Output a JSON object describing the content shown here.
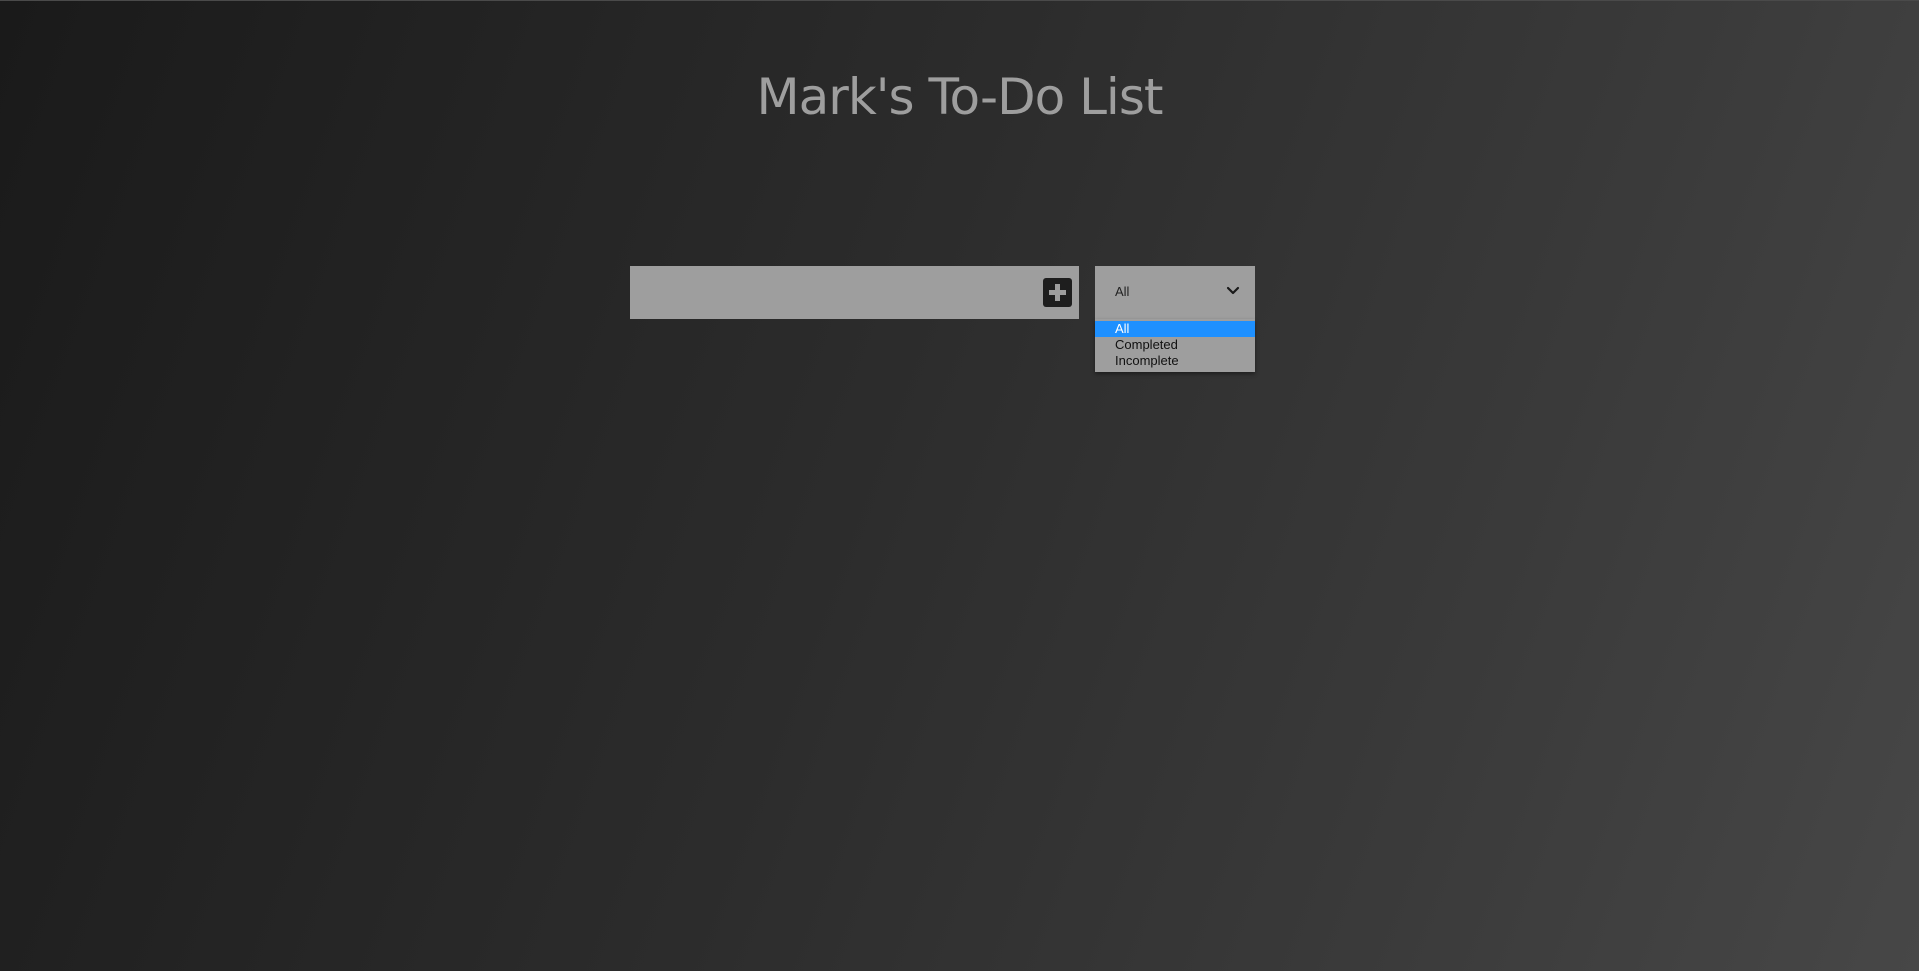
{
  "header": {
    "title": "Mark's To-Do List"
  },
  "todo_form": {
    "input_value": "",
    "add_button_icon": "plus-square-icon"
  },
  "filter": {
    "selected": "All",
    "chevron_icon": "chevron-down-icon",
    "options": [
      {
        "label": "All",
        "selected": true
      },
      {
        "label": "Completed",
        "selected": false
      },
      {
        "label": "Incomplete",
        "selected": false
      }
    ]
  },
  "colors": {
    "accent_selected": "#1e90ff",
    "control_bg": "#9e9e9e",
    "button_bg": "#1e1e1e",
    "title_color": "#9e9e9e"
  }
}
